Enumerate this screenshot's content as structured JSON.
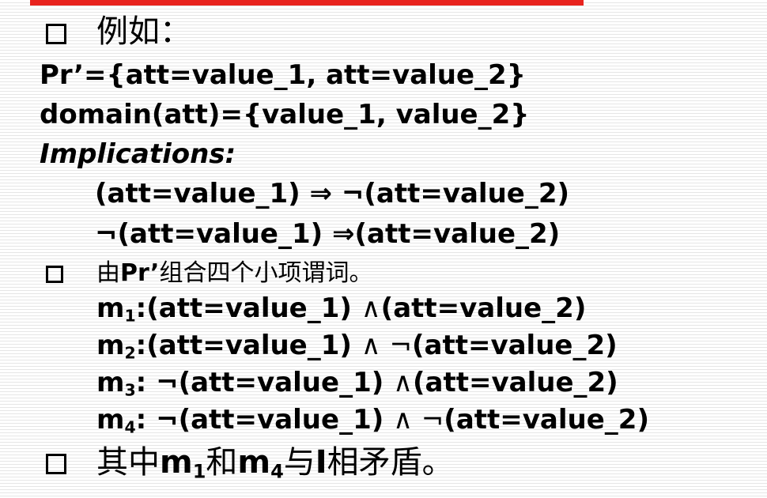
{
  "bullets": {
    "example_label": "例如：",
    "item2_prefix": "由",
    "item2_bold": "Pr’",
    "item2_suffix": "组合四个小项谓词。",
    "item3_prefix": "其中",
    "item3_m1": "m",
    "item3_m1_sub": "1",
    "item3_and": "和",
    "item3_m4": "m",
    "item3_m4_sub": "4",
    "item3_with": "与",
    "item3_I": "I",
    "item3_suffix": "相矛盾。"
  },
  "lines": {
    "pr": "Pr’={att=value_1, att=value_2}",
    "domain": "domain(att)={value_1, value_2}",
    "implications_label": "Implications:",
    "impl1": "(att=value_1) ⇒ ¬(att=value_2)",
    "impl2": "¬(att=value_1) ⇒(att=value_2)"
  },
  "minterms": [
    {
      "name": "m",
      "sub": "1",
      "expr_a": ":(att=value_1) ",
      "op": "∧",
      "expr_b": "(att=value_2)"
    },
    {
      "name": "m",
      "sub": "2",
      "expr_a": ":(att=value_1) ",
      "op": "∧ ¬",
      "expr_b": "(att=value_2)"
    },
    {
      "name": "m",
      "sub": "3",
      "expr_a": ": ¬(att=value_1) ",
      "op": "∧",
      "expr_b": "(att=value_2)"
    },
    {
      "name": "m",
      "sub": "4",
      "expr_a": ": ¬(att=value_1) ",
      "op": "∧ ¬",
      "expr_b": "(att=value_2)"
    }
  ],
  "colors": {
    "accent_bar": "#e8231e",
    "text": "#000000"
  }
}
